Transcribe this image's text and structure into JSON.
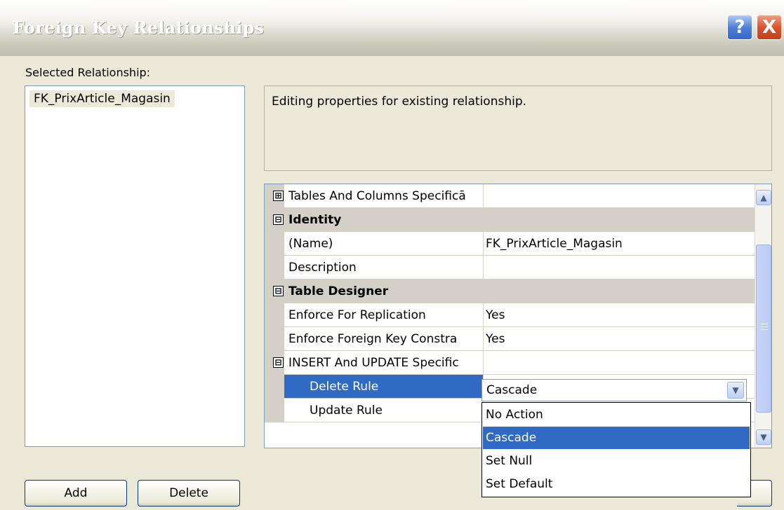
{
  "window": {
    "title": "Foreign Key Relationships",
    "help_glyph": "?",
    "close_glyph": "X"
  },
  "left": {
    "selected_label": "Selected Relationship:",
    "relationships": [
      "FK_PrixArticle_Magasin"
    ],
    "add_label": "Add",
    "delete_label": "Delete"
  },
  "description": "Editing properties for existing relationship.",
  "properties": {
    "rows": [
      {
        "type": "collapsed",
        "name": "Tables And Columns Specificā",
        "value": ""
      },
      {
        "type": "category",
        "name": "Identity"
      },
      {
        "type": "prop",
        "name": "(Name)",
        "value": "FK_PrixArticle_Magasin"
      },
      {
        "type": "prop",
        "name": "Description",
        "value": ""
      },
      {
        "type": "category",
        "name": "Table Designer"
      },
      {
        "type": "prop",
        "name": "Enforce For Replication",
        "value": "Yes"
      },
      {
        "type": "prop",
        "name": "Enforce Foreign Key Constra",
        "value": "Yes"
      },
      {
        "type": "expanded",
        "name": "INSERT And UPDATE Specific",
        "value": ""
      },
      {
        "type": "sub-selected",
        "name": "Delete Rule",
        "value": "Cascade"
      },
      {
        "type": "sub",
        "name": "Update Rule",
        "value": ""
      }
    ]
  },
  "combo": {
    "value": "Cascade",
    "options": [
      "No Action",
      "Cascade",
      "Set Null",
      "Set Default"
    ],
    "highlighted_index": 1
  },
  "icons": {
    "expand": "⊞",
    "collapse": "⊟",
    "scroll_up": "▲",
    "scroll_down": "▼",
    "combo_arrow": "▼"
  },
  "colors": {
    "selection": "#316ac5",
    "dialog_bg": "#ece9d8"
  }
}
